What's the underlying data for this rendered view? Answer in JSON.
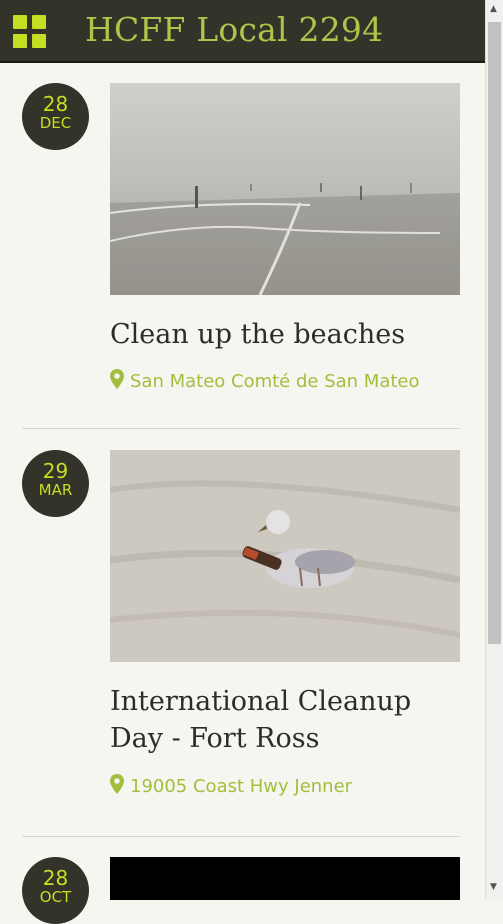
{
  "header": {
    "title": "HCFF Local 2294",
    "menu_icon": "grid-menu-icon"
  },
  "colors": {
    "header_bg": "#33332a",
    "accent": "#c4de22",
    "location": "#a2be3c"
  },
  "events": [
    {
      "day": "28",
      "month": "DEC",
      "title": "Clean up the beaches",
      "location": "San Mateo Comté de San Mateo"
    },
    {
      "day": "29",
      "month": "MAR",
      "title": "International Cleanup Day - Fort Ross",
      "location": "19005 Coast Hwy Jenner"
    },
    {
      "day": "28",
      "month": "OCT"
    }
  ]
}
